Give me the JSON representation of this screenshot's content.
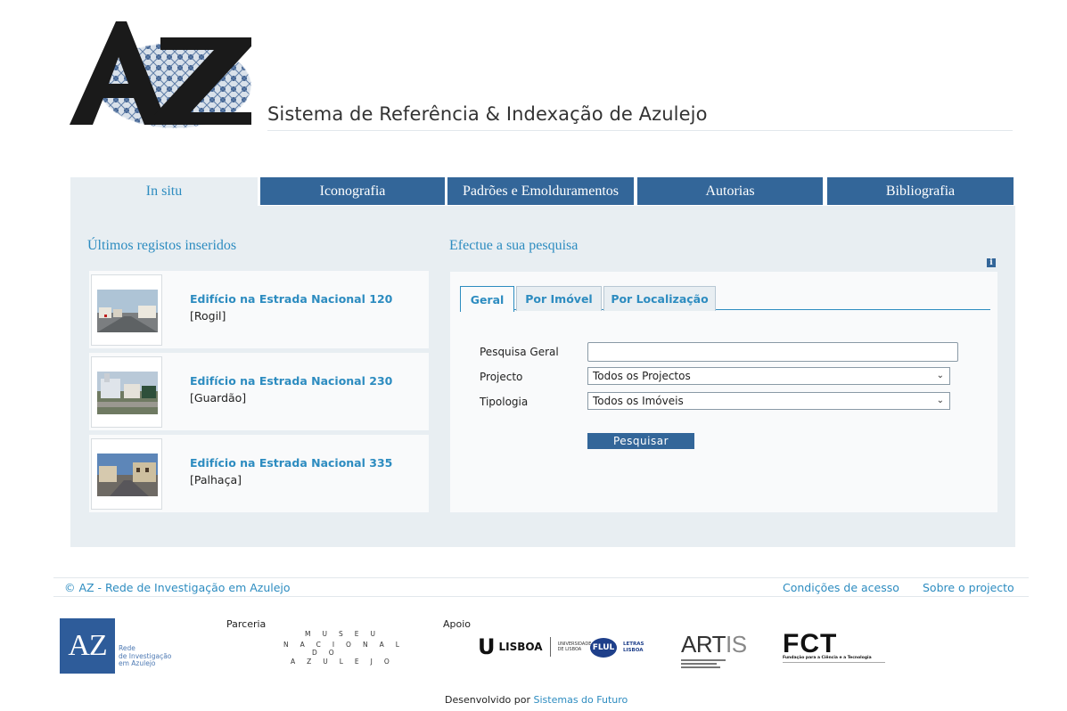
{
  "header": {
    "logo_text": "AZ",
    "site_title": "Sistema de Referência  & Indexação de Azulejo"
  },
  "nav": {
    "tabs": [
      {
        "label": "In situ",
        "active": true
      },
      {
        "label": "Iconografia",
        "active": false
      },
      {
        "label": "Padrões e Emolduramentos",
        "active": false
      },
      {
        "label": "Autorias",
        "active": false
      },
      {
        "label": "Bibliografia",
        "active": false
      }
    ]
  },
  "recent": {
    "title": "Últimos registos inseridos",
    "items": [
      {
        "title": "Edifício na Estrada Nacional 120",
        "location": "[Rogil]"
      },
      {
        "title": "Edifício na Estrada Nacional 230",
        "location": "[Guardão]"
      },
      {
        "title": "Edifício na Estrada Nacional 335",
        "location": "[Palhaça]"
      }
    ]
  },
  "search": {
    "title": "Efectue a sua pesquisa",
    "info_icon": "i",
    "tabs": [
      {
        "label": "Geral",
        "active": true
      },
      {
        "label": "Por Imóvel",
        "active": false
      },
      {
        "label": "Por Localização",
        "active": false
      }
    ],
    "fields": {
      "general_label": "Pesquisa Geral",
      "general_value": "",
      "project_label": "Projecto",
      "project_value": "Todos os Projectos",
      "typology_label": "Tipologia",
      "typology_value": "Todos os Imóveis"
    },
    "submit_label": "Pesquisar"
  },
  "footer": {
    "copyright": "© AZ - Rede de Investigação em Azulejo",
    "links": [
      "Condições de acesso",
      "Sobre o projecto"
    ],
    "partnership_label": "Parceria",
    "support_label": "Apoio",
    "az_logo_text": "AZ",
    "az_logo_caption": [
      "Rede",
      "de Investigação",
      "em Azulejo"
    ],
    "museu_lines": [
      "MUSEU",
      "NACIONAL",
      "DO",
      "AZULEJO"
    ],
    "ulisboa": {
      "u": "U",
      "lisboa": "LISBOA",
      "caption": [
        "UNIVERSIDADE",
        "DE LISBOA"
      ]
    },
    "flul": {
      "badge": "FLUL",
      "caption": [
        "LETRAS",
        "LISBOA"
      ]
    },
    "artis": {
      "bold": "ART",
      "light": "IS"
    },
    "fct": {
      "title": "FCT",
      "caption": "Fundação para a Ciência e a Tecnologia"
    },
    "developed_by": "Desenvolvido por",
    "developer": "Sistemas do Futuro"
  }
}
